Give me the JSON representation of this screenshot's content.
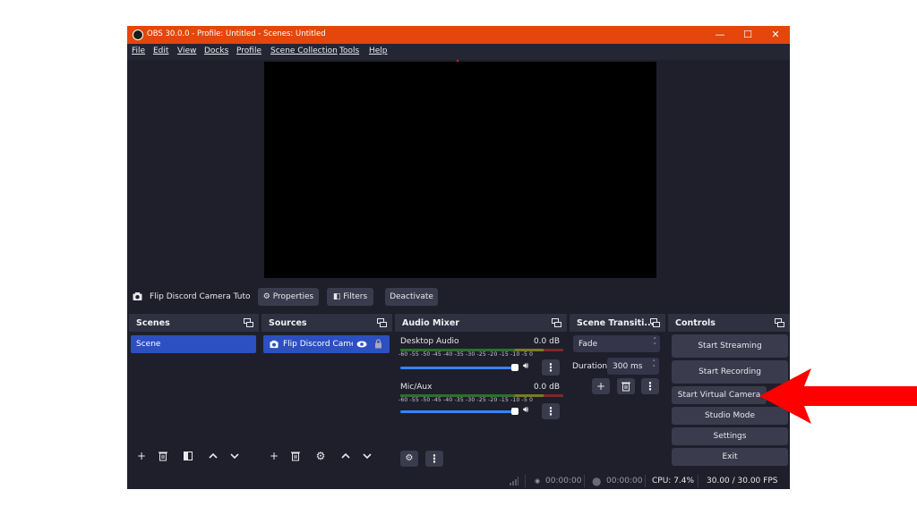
{
  "window": {
    "title": "OBS 30.0.0 - Profile: Untitled - Scenes: Untitled",
    "controls": {
      "minimize": "—",
      "maximize": "☐",
      "close": "✕"
    }
  },
  "menu": [
    "File",
    "Edit",
    "View",
    "Docks",
    "Profile",
    "Scene Collection",
    "Tools",
    "Help"
  ],
  "source_bar": {
    "source_name": "Flip Discord Camera Tutorial",
    "properties_label": "Properties",
    "filters_label": "Filters",
    "deactivate_label": "Deactivate"
  },
  "docks": {
    "scenes": {
      "title": "Scenes",
      "items": [
        "Scene"
      ]
    },
    "sources": {
      "title": "Sources",
      "items": [
        "Flip Discord Camera"
      ]
    },
    "mixer": {
      "title": "Audio Mixer",
      "channels": [
        {
          "name": "Desktop Audio",
          "db": "0.0 dB"
        },
        {
          "name": "Mic/Aux",
          "db": "0.0 dB"
        }
      ],
      "ticks": "-60 -55 -50 -45 -40 -35 -30 -25 -20 -15 -10 -5 0"
    },
    "transitions": {
      "title": "Scene Transiti...",
      "transition": "Fade",
      "duration_label": "Duration",
      "duration_value": "300 ms"
    },
    "controls": {
      "title": "Controls",
      "buttons": [
        "Start Streaming",
        "Start Recording",
        "Start Virtual Camera",
        "Studio Mode",
        "Settings",
        "Exit"
      ]
    }
  },
  "status": {
    "stream_time": "00:00:00",
    "record_time": "00:00:00",
    "cpu": "CPU: 7.4%",
    "fps": "30.00 / 30.00 FPS"
  },
  "colors": {
    "titlebar": "#e4460c",
    "selection": "#2c4fc2",
    "annotation_arrow": "#ff0000"
  }
}
